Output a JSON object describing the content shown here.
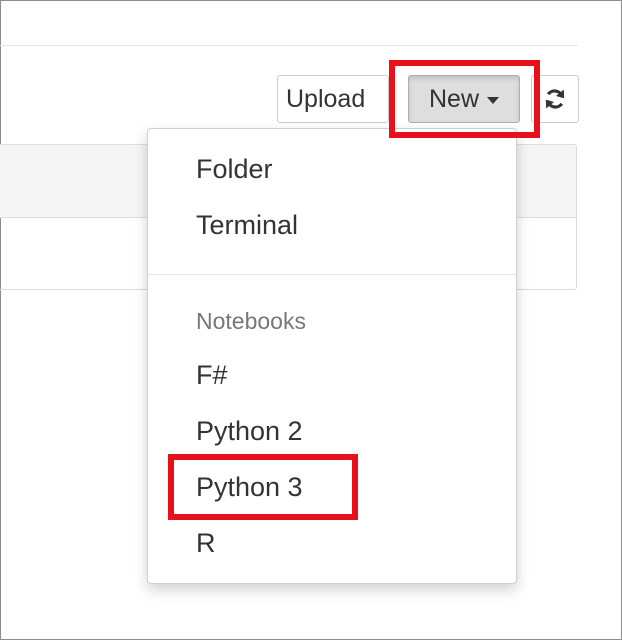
{
  "toolbar": {
    "upload_label": "Upload",
    "new_label": "New",
    "refresh_icon": "refresh-icon"
  },
  "new_menu": {
    "items": [
      {
        "label": "Folder"
      },
      {
        "label": "Terminal"
      }
    ],
    "notebooks_header": "Notebooks",
    "notebooks": [
      {
        "label": "F#"
      },
      {
        "label": "Python 2"
      },
      {
        "label": "Python 3"
      },
      {
        "label": "R"
      }
    ]
  },
  "colors": {
    "highlight": "#e8111b",
    "active_button": "#dedede"
  }
}
